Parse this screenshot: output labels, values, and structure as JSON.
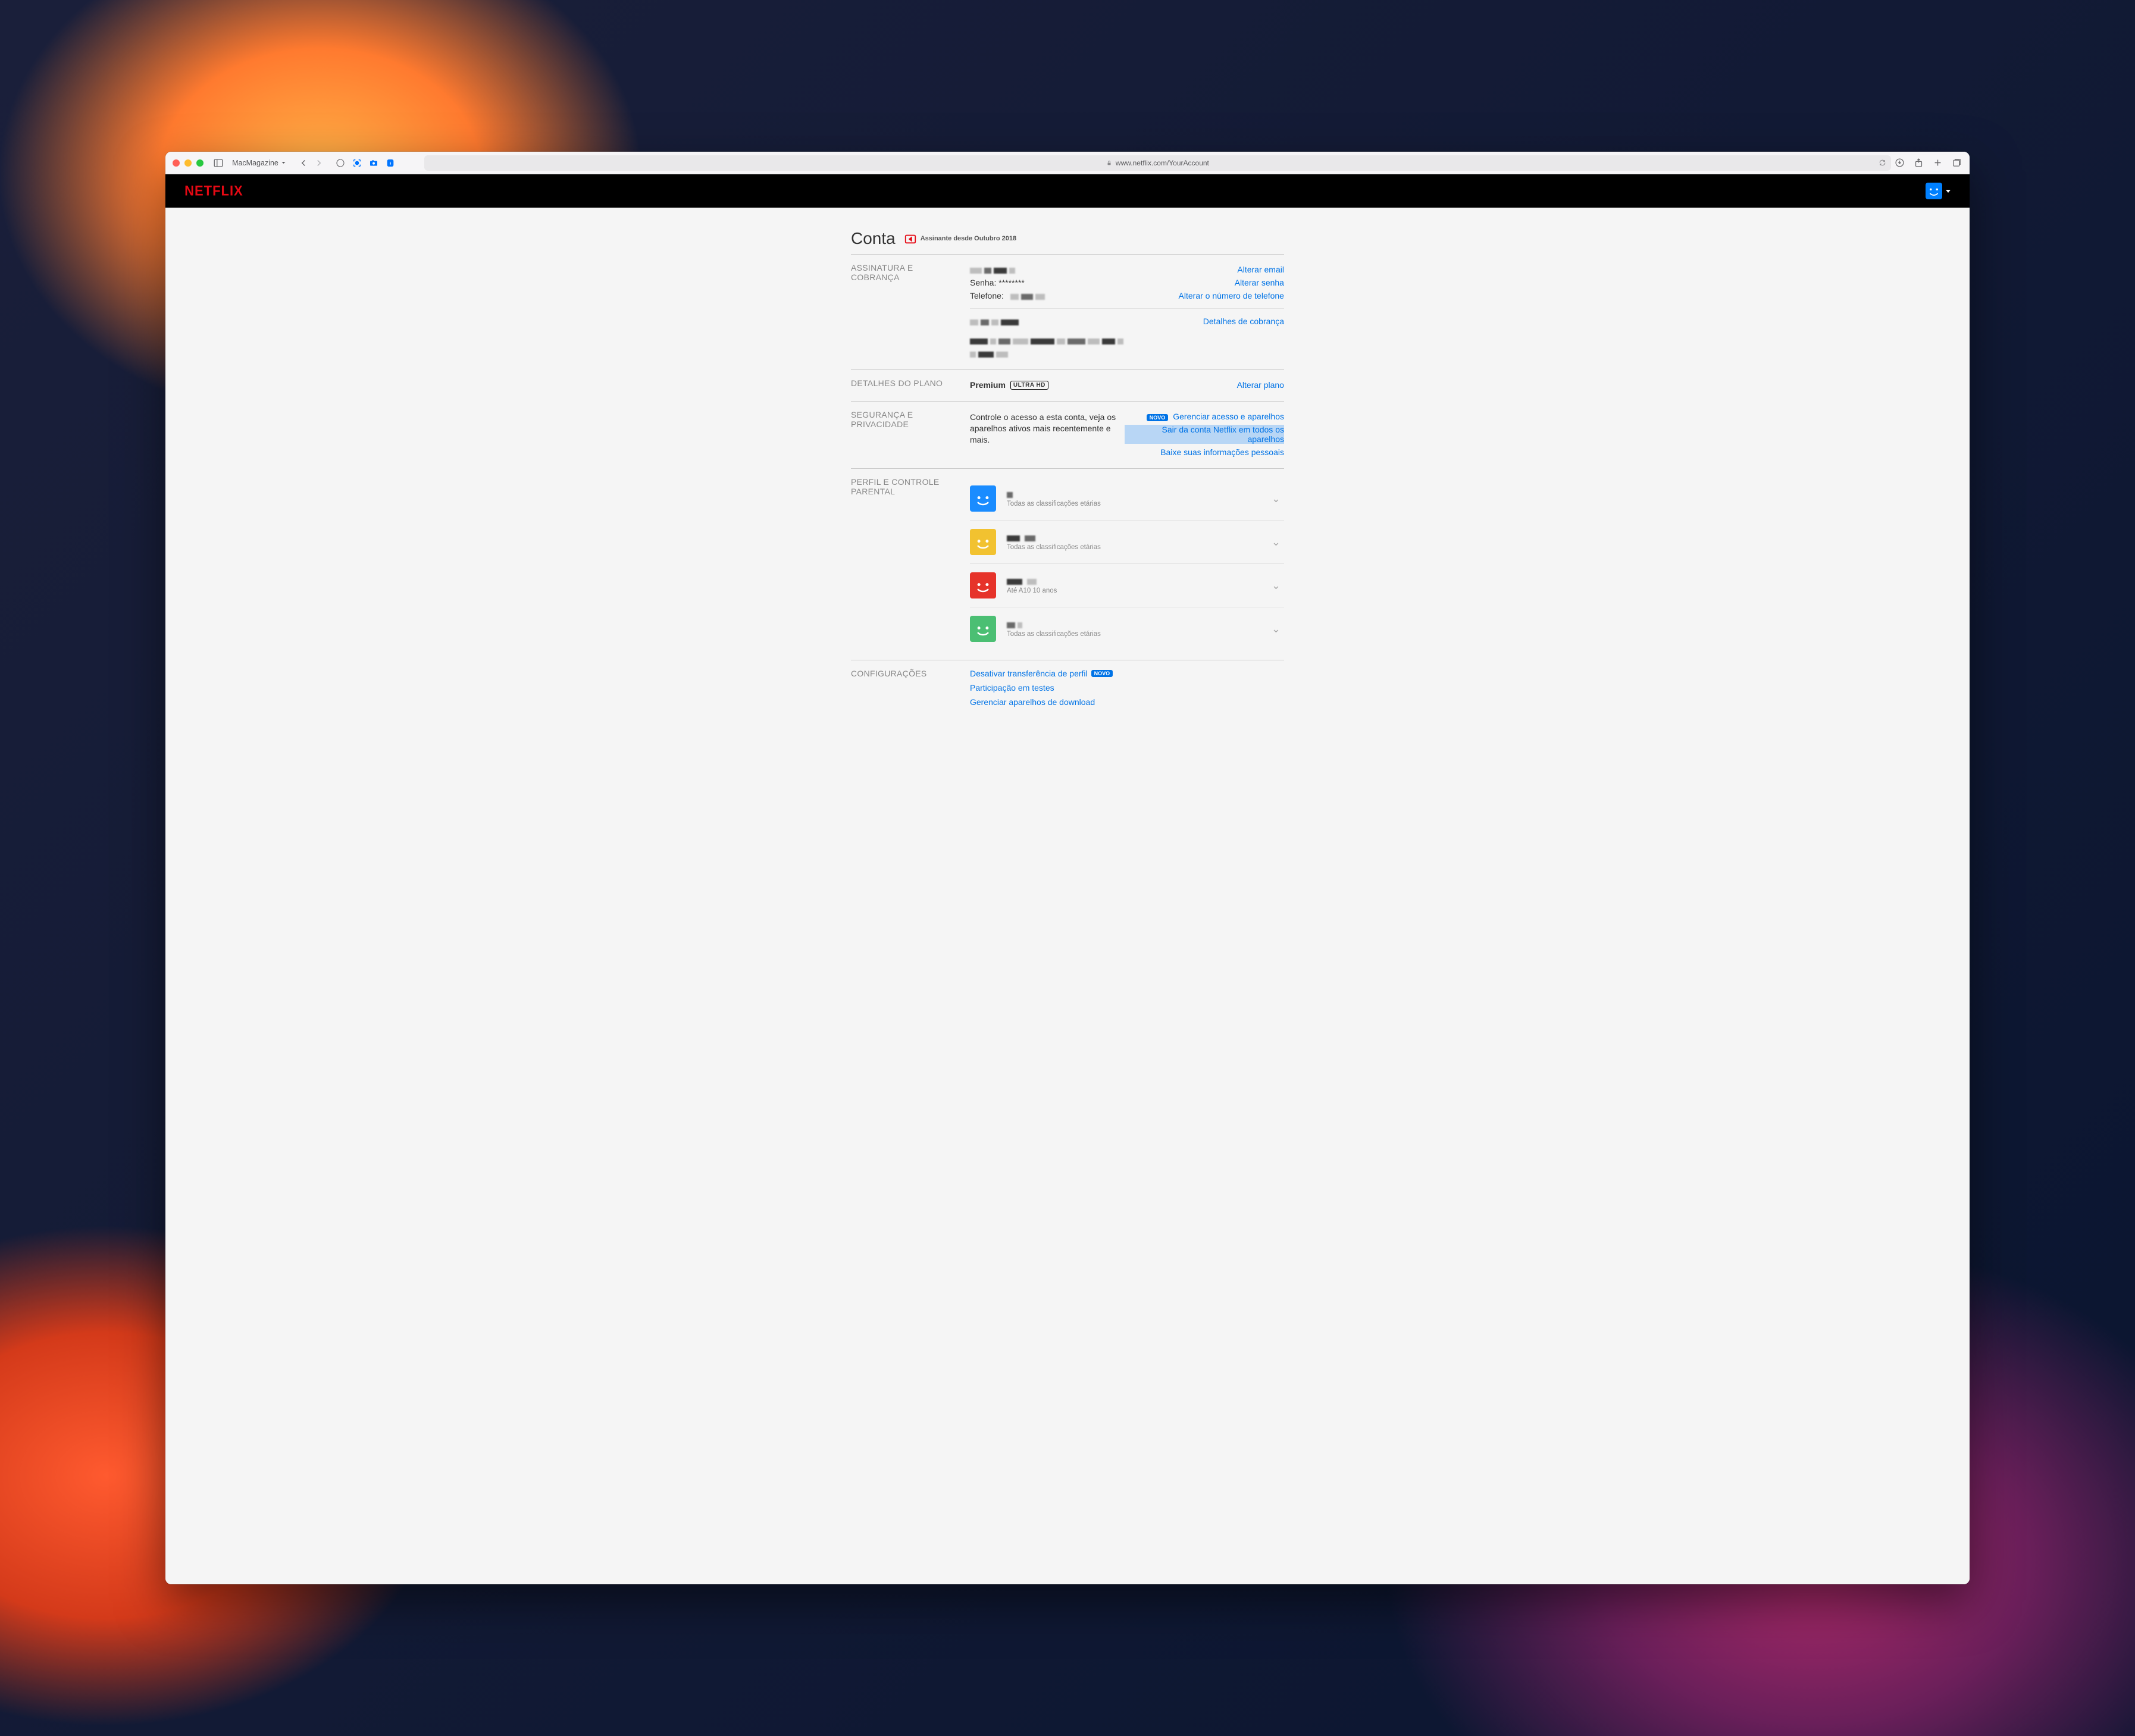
{
  "browser": {
    "tab_group": "MacMagazine",
    "url_display": "www.netflix.com/YourAccount",
    "url_prefix_icon": "lock"
  },
  "topbar": {
    "logo_text": "NETFLIX",
    "profile_avatar_color": "#0073e6"
  },
  "page": {
    "title": "Conta",
    "member_since": "Assinante desde Outubro 2018"
  },
  "subscription": {
    "section_label": "ASSINATURA E COBRANÇA",
    "email_redacted": true,
    "password_label": "Senha:",
    "password_mask": "********",
    "phone_label": "Telefone:",
    "phone_redacted": true,
    "links": {
      "change_email": "Alterar email",
      "change_password": "Alterar senha",
      "change_phone": "Alterar o número de telefone",
      "billing_details": "Detalhes de cobrança"
    }
  },
  "plan": {
    "section_label": "DETALHES DO PLANO",
    "name": "Premium",
    "badge": "ULTRA HD",
    "change_link": "Alterar plano"
  },
  "security": {
    "section_label": "SEGURANÇA E PRIVACIDADE",
    "description": "Controle o acesso a esta conta, veja os aparelhos ativos mais recentemente e mais.",
    "novo_label": "NOVO",
    "links": {
      "manage_devices": "Gerenciar acesso e aparelhos",
      "sign_out_all": "Sair da conta Netflix em todos os aparelhos",
      "download_info": "Baixe suas informações pessoais"
    }
  },
  "profiles": {
    "section_label": "PERFIL E CONTROLE PARENTAL",
    "rating_all": "Todas as classificações etárias",
    "items": [
      {
        "color": "#0073e6",
        "name_redacted": true,
        "rating": "Todas as classificações etárias"
      },
      {
        "color": "#f2c230",
        "name_redacted": true,
        "rating": "Todas as classificações etárias"
      },
      {
        "color": "#e6332a",
        "name_redacted": true,
        "rating": "Até A10  10 anos"
      },
      {
        "color": "#4bbf73",
        "name_redacted": true,
        "rating": "Todas as classificações etárias"
      }
    ]
  },
  "settings": {
    "section_label": "CONFIGURAÇÕES",
    "novo_label": "NOVO",
    "links": {
      "disable_transfer": "Desativar transferência de perfil",
      "test_participation": "Participação em testes",
      "manage_downloads": "Gerenciar aparelhos de download"
    }
  }
}
